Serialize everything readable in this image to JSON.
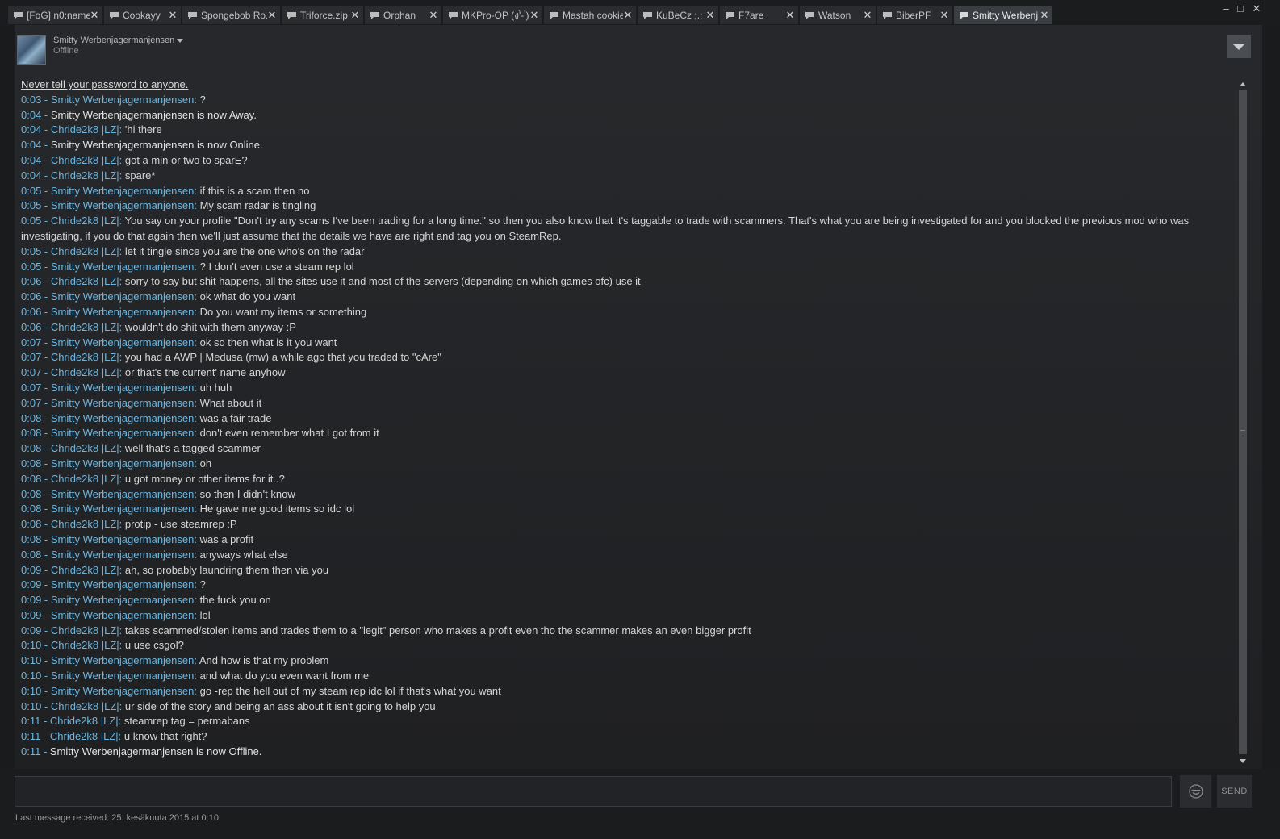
{
  "window": {
    "minimize_glyph": "–",
    "maximize_glyph": "□",
    "close_glyph": "✕"
  },
  "tabs": [
    {
      "label": "[FoG] n0:name",
      "active": false
    },
    {
      "label": "Cookayy",
      "active": false
    },
    {
      "label": "Spongebob Ro...",
      "active": false
    },
    {
      "label": "Triforce.zip",
      "active": false
    },
    {
      "label": "Orphan",
      "active": false
    },
    {
      "label": "MKPro-OP (ง'̀-'́)ง",
      "active": false
    },
    {
      "label": "Mastah cookie",
      "active": false
    },
    {
      "label": "KuBeCz ;.;",
      "active": false
    },
    {
      "label": "F7are",
      "active": false
    },
    {
      "label": "Watson",
      "active": false
    },
    {
      "label": "BiberPF",
      "active": false
    },
    {
      "label": "Smitty Werbenj...",
      "active": true
    }
  ],
  "header": {
    "username": "Smitty Werbenjagermanjensen",
    "status": "Offline",
    "avatar_icon": "avatar-image",
    "menu_icon": "chevron-down-icon"
  },
  "chat": {
    "notice": "Never tell your password to anyone.",
    "messages": [
      {
        "meta": "0:03 - Smitty Werbenjagermanjensen:",
        "text": " ?",
        "type": "msg"
      },
      {
        "meta": "0:04 - ",
        "text": "Smitty Werbenjagermanjensen is now Away.",
        "type": "status"
      },
      {
        "meta": "0:04 - Chride2k8 |LZ|:",
        "text": " 'hi there",
        "type": "msg"
      },
      {
        "meta": "0:04 - ",
        "text": "Smitty Werbenjagermanjensen is now Online.",
        "type": "status"
      },
      {
        "meta": "0:04 - Chride2k8 |LZ|:",
        "text": " got a min or two to sparE?",
        "type": "msg"
      },
      {
        "meta": "0:04 - Chride2k8 |LZ|:",
        "text": " spare*",
        "type": "msg"
      },
      {
        "meta": "0:05 - Smitty Werbenjagermanjensen:",
        "text": " if this is a scam then no",
        "type": "msg"
      },
      {
        "meta": "0:05 - Smitty Werbenjagermanjensen:",
        "text": " My scam radar is tingling",
        "type": "msg"
      },
      {
        "meta": "0:05 - Chride2k8 |LZ|:",
        "text": " You say on your profile \"Don't try any scams I've been trading for a long time.\" so then you also know that it's taggable to trade with scammers. That's what you are being investigated for and you blocked the previous mod who was investigating, if you do that again then we'll just assume that the details we have are right and tag you on SteamRep.",
        "type": "msg"
      },
      {
        "meta": "0:05 - Chride2k8 |LZ|:",
        "text": " let it tingle since you are the one who's on the radar",
        "type": "msg"
      },
      {
        "meta": "0:05 - Smitty Werbenjagermanjensen:",
        "text": " ? I don't even use a steam rep lol",
        "type": "msg"
      },
      {
        "meta": "0:06 - Chride2k8 |LZ|:",
        "text": " sorry to say but shit happens, all the sites use it and most of the servers (depending on which games ofc) use it",
        "type": "msg"
      },
      {
        "meta": "0:06 - Smitty Werbenjagermanjensen:",
        "text": " ok what do you want",
        "type": "msg"
      },
      {
        "meta": "0:06 - Smitty Werbenjagermanjensen:",
        "text": " Do you want my items or something",
        "type": "msg"
      },
      {
        "meta": "0:06 - Chride2k8 |LZ|:",
        "text": " wouldn't do shit with them anyway :P",
        "type": "msg"
      },
      {
        "meta": "0:07 - Smitty Werbenjagermanjensen:",
        "text": " ok so then what is it you want",
        "type": "msg"
      },
      {
        "meta": "0:07 - Chride2k8 |LZ|:",
        "text": " you had a AWP | Medusa (mw) a while ago that you traded to \"cAre\"",
        "type": "msg"
      },
      {
        "meta": "0:07 - Chride2k8 |LZ|:",
        "text": " or that's the current' name anyhow",
        "type": "msg"
      },
      {
        "meta": "0:07 - Smitty Werbenjagermanjensen:",
        "text": " uh huh",
        "type": "msg"
      },
      {
        "meta": "0:07 - Smitty Werbenjagermanjensen:",
        "text": " What about it",
        "type": "msg"
      },
      {
        "meta": "0:08 - Smitty Werbenjagermanjensen:",
        "text": " was a fair trade",
        "type": "msg"
      },
      {
        "meta": "0:08 - Smitty Werbenjagermanjensen:",
        "text": " don't even remember what I got from it",
        "type": "msg"
      },
      {
        "meta": "0:08 - Chride2k8 |LZ|:",
        "text": " well that's a tagged scammer",
        "type": "msg"
      },
      {
        "meta": "0:08 - Smitty Werbenjagermanjensen:",
        "text": " oh",
        "type": "msg"
      },
      {
        "meta": "0:08 - Chride2k8 |LZ|:",
        "text": " u got money or other items for it..?",
        "type": "msg"
      },
      {
        "meta": "0:08 - Smitty Werbenjagermanjensen:",
        "text": " so then I didn't know",
        "type": "msg"
      },
      {
        "meta": "0:08 - Smitty Werbenjagermanjensen:",
        "text": " He gave me good items so idc lol",
        "type": "msg"
      },
      {
        "meta": "0:08 - Chride2k8 |LZ|:",
        "text": " protip - use steamrep :P",
        "type": "msg"
      },
      {
        "meta": "0:08 - Smitty Werbenjagermanjensen:",
        "text": " was a profit",
        "type": "msg"
      },
      {
        "meta": "0:08 - Smitty Werbenjagermanjensen:",
        "text": " anyways what else",
        "type": "msg"
      },
      {
        "meta": "0:09 - Chride2k8 |LZ|:",
        "text": " ah, so probably laundring them then via you",
        "type": "msg"
      },
      {
        "meta": "0:09 - Smitty Werbenjagermanjensen:",
        "text": " ?",
        "type": "msg"
      },
      {
        "meta": "0:09 - Smitty Werbenjagermanjensen:",
        "text": " the fuck you on",
        "type": "msg"
      },
      {
        "meta": "0:09 - Smitty Werbenjagermanjensen:",
        "text": " lol",
        "type": "msg"
      },
      {
        "meta": "0:09 - Chride2k8 |LZ|:",
        "text": " takes scammed/stolen items and trades them to a \"legit\" person who makes a profit even tho the scammer makes an even bigger profit",
        "type": "msg"
      },
      {
        "meta": "0:10 - Chride2k8 |LZ|:",
        "text": " u use csgol?",
        "type": "msg"
      },
      {
        "meta": "0:10 - Smitty Werbenjagermanjensen:",
        "text": " And how is that my problem",
        "type": "msg"
      },
      {
        "meta": "0:10 - Smitty Werbenjagermanjensen:",
        "text": " and what do you even want from me",
        "type": "msg"
      },
      {
        "meta": "0:10 - Smitty Werbenjagermanjensen:",
        "text": " go -rep the hell out of my steam rep idc lol if that's what you want",
        "type": "msg"
      },
      {
        "meta": "0:10 - Chride2k8 |LZ|:",
        "text": " ur side of the story and being an ass about it isn't going to help you",
        "type": "msg"
      },
      {
        "meta": "0:11 - Chride2k8 |LZ|:",
        "text": " steamrep tag = permabans",
        "type": "msg"
      },
      {
        "meta": "0:11 - Chride2k8 |LZ|:",
        "text": " u know that right?",
        "type": "msg"
      },
      {
        "meta": "0:11 - ",
        "text": "Smitty Werbenjagermanjensen is now Offline.",
        "type": "status"
      }
    ]
  },
  "composer": {
    "input_value": "",
    "emoji_icon": "smiley-icon",
    "send_label": "SEND",
    "last_message": "Last message received: 25. kesäkuuta 2015 at 0:10"
  },
  "colors": {
    "timestamp_name": "#6cb6e0",
    "background": "#1a1b1d",
    "panel": "#26282b"
  }
}
